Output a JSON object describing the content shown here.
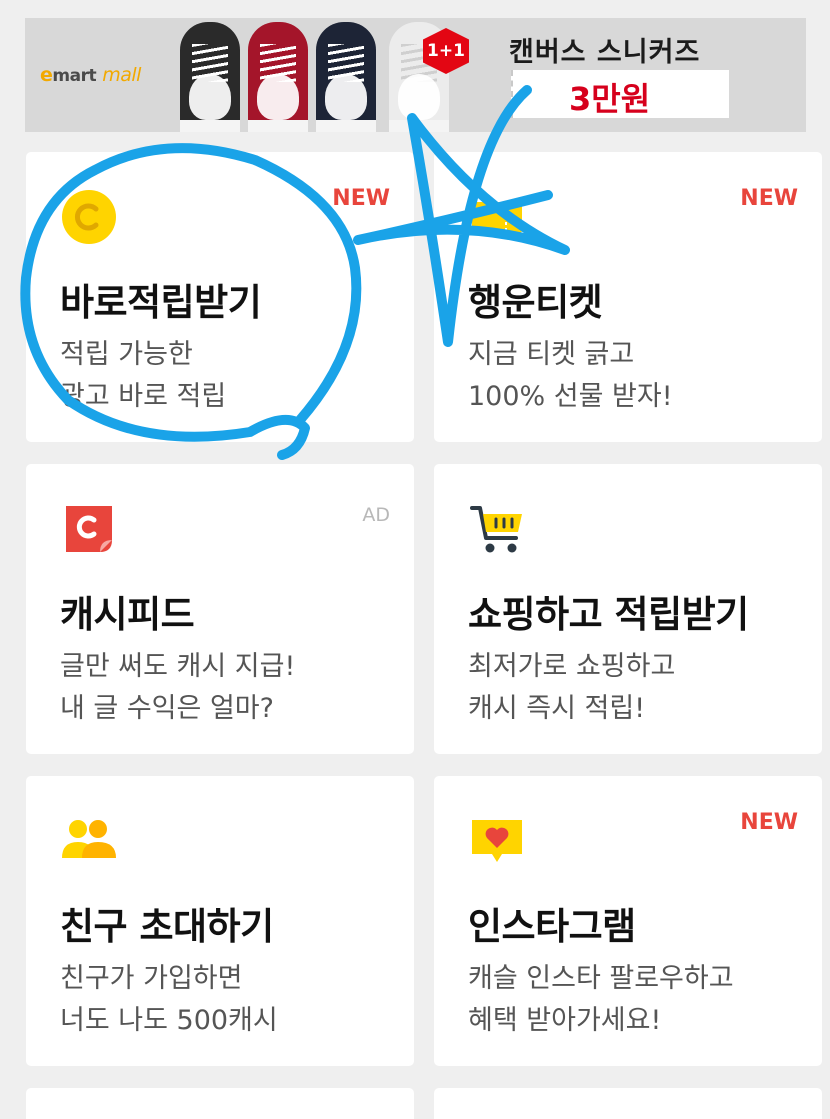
{
  "banner": {
    "brand_e": "e",
    "brand_mart": "mart",
    "brand_mall": "mall",
    "badge": "1+1",
    "title": "캔버스 스니커즈",
    "price": "3만원",
    "shoe_colors": [
      "#2a2a2a",
      "#a4152a",
      "#1d2436",
      "#ececec"
    ]
  },
  "cards": [
    {
      "title": "바로적립받기",
      "tag": "NEW",
      "desc": [
        "적립 가능한",
        "광고 바로 적립"
      ],
      "icon": "coin-icon"
    },
    {
      "title": "행운티켓",
      "tag": "NEW",
      "desc": [
        "지금 티켓 긁고",
        "100% 선물 받자!"
      ],
      "icon": "ticket-icon"
    },
    {
      "title": "캐시피드",
      "tag": "AD",
      "desc": [
        "글만 써도 캐시 지급!",
        "내 글 수익은 얼마?"
      ],
      "icon": "cashfeed-icon"
    },
    {
      "title": "쇼핑하고 적립받기",
      "tag": "",
      "desc": [
        "최저가로 쇼핑하고",
        "캐시 즉시 적립!"
      ],
      "icon": "shopping-cart-icon"
    },
    {
      "title": "친구 초대하기",
      "tag": "",
      "desc": [
        "친구가 가입하면",
        "너도 나도 500캐시"
      ],
      "icon": "friends-icon"
    },
    {
      "title": "인스타그램",
      "tag": "NEW",
      "desc": [
        "캐슬 인스타 팔로우하고",
        "혜택 받아가세요!"
      ],
      "icon": "heart-message-icon"
    }
  ],
  "colors": {
    "accent_new": "#e8453c",
    "icon_yellow": "#ffd400",
    "icon_red": "#e8453c",
    "scribble_blue": "#1aa3e8",
    "background": "#efefef"
  }
}
